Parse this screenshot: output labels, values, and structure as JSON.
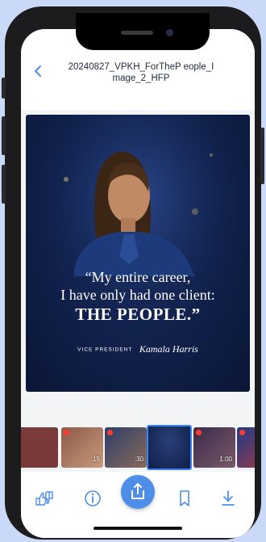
{
  "header": {
    "title": "20240827_VPKH_ForTheP eople_Image_2_HFP",
    "back_icon": "chevron-left-icon"
  },
  "poster": {
    "quote_line1": "“My entire career,",
    "quote_line2": "I have only had one client:",
    "quote_line3": "THE PEOPLE.”",
    "role": "VICE PRESIDENT",
    "name": "Kamala Harris"
  },
  "thumbnails": [
    {
      "duration": "",
      "selected": false
    },
    {
      "duration": ":15",
      "selected": false
    },
    {
      "duration": ":30",
      "selected": false
    },
    {
      "duration": "",
      "selected": true
    },
    {
      "duration": "1:00",
      "selected": false
    },
    {
      "duration": "",
      "selected": false
    },
    {
      "duration": "",
      "selected": false
    }
  ],
  "toolbar": {
    "feedback_icon": "thumbs-up-down-icon",
    "info_icon": "info-icon",
    "share_icon": "share-icon",
    "bookmark_icon": "bookmark-icon",
    "download_icon": "download-icon"
  },
  "colors": {
    "accent": "#4d8ee8",
    "background": "#c9d9f7",
    "poster_navy": "#10204a",
    "recording_dot": "#ff3b30"
  }
}
